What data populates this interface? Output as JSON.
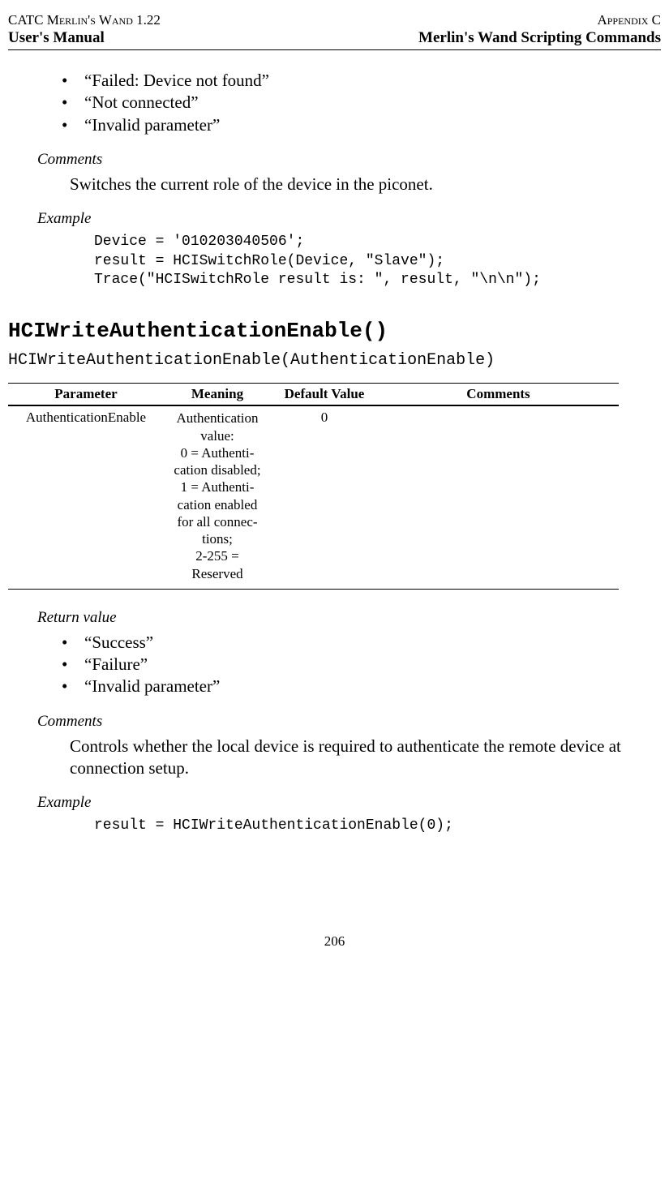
{
  "header": {
    "top_left": "CATC Merlin's Wand 1.22",
    "top_right": "Appendix C",
    "sub_left": "User's Manual",
    "sub_right": "Merlin's Wand Scripting Commands"
  },
  "top_bullets": [
    "“Failed: Device not found”",
    "“Not connected”",
    "“Invalid parameter”"
  ],
  "section1": {
    "comments_label": "Comments",
    "comments_text": "Switches the current role of the device in the piconet.",
    "example_label": "Example",
    "code": "Device = '010203040506';\nresult = HCISwitchRole(Device, \"Slave\");\nTrace(\"HCISwitchRole result is: \", result, \"\\n\\n\");"
  },
  "func": {
    "title": "HCIWriteAuthenticationEnable()",
    "signature": "HCIWriteAuthenticationEnable(AuthenticationEnable)"
  },
  "table": {
    "headers": {
      "parameter": "Parameter",
      "meaning": "Meaning",
      "default": "Default Value",
      "comments": "Comments"
    },
    "row": {
      "parameter": "AuthenticationEnable",
      "meaning": "Authentica­tion value:\n0 = Authenti­cation dis­abled;\n1 = Authenti­cation enabled for all connec­tions;\n2-255 = Reserved",
      "default": "0",
      "comments": ""
    }
  },
  "section2": {
    "return_label": "Return value",
    "return_bullets": [
      "“Success”",
      "“Failure”",
      "“Invalid parameter”"
    ],
    "comments_label": "Comments",
    "comments_text": "Controls whether the local device is required to authenticate the remote device at connection setup.",
    "example_label": "Example",
    "code": "result = HCIWriteAuthenticationEnable(0);"
  },
  "page_number": "206"
}
